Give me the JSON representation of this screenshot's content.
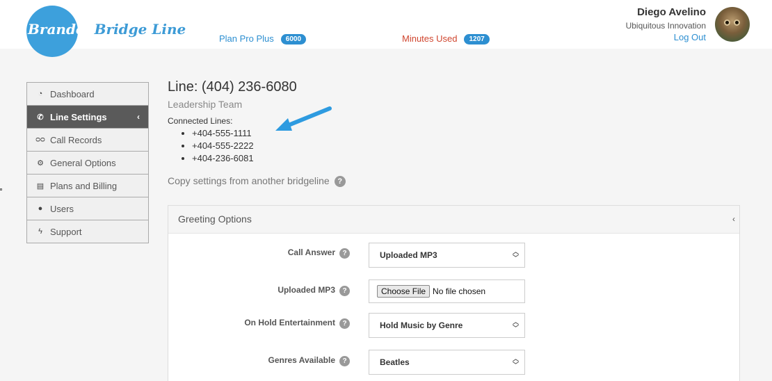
{
  "header": {
    "logo": {
      "text_branded": "Branded",
      "text_bridgeline": "Bridge Line"
    },
    "plan": {
      "label": "Plan Pro Plus",
      "badge": "6000"
    },
    "minutes": {
      "label": "Minutes Used",
      "badge": "1207"
    },
    "user": {
      "name": "Diego Avelino",
      "org": "Ubiquitous Innovation",
      "logout": "Log Out"
    }
  },
  "sidebar": {
    "items": [
      {
        "label": "Dashboard",
        "icon": "gauge-icon"
      },
      {
        "label": "Line Settings",
        "icon": "phone-icon",
        "active": true
      },
      {
        "label": "Call Records",
        "icon": "voicemail-icon"
      },
      {
        "label": "General Options",
        "icon": "gear-icon"
      },
      {
        "label": "Plans and Billing",
        "icon": "card-icon"
      },
      {
        "label": "Users",
        "icon": "user-icon"
      },
      {
        "label": "Support",
        "icon": "bolt-icon"
      }
    ]
  },
  "main": {
    "line_title": "Line: (404) 236-6080",
    "line_subtitle": "Leadership Team",
    "connected_label": "Connected Lines:",
    "connected_lines": [
      "+404-555-1111",
      "+404-555-2222",
      "+404-236-6081"
    ],
    "copy_settings": "Copy settings from another bridgeline",
    "help_glyph": "?"
  },
  "greeting": {
    "title": "Greeting Options",
    "fields": {
      "call_answer": {
        "label": "Call Answer",
        "value": "Uploaded MP3"
      },
      "uploaded_mp3": {
        "label": "Uploaded MP3",
        "button": "Choose File",
        "status": "No file chosen"
      },
      "on_hold": {
        "label": "On Hold Entertainment",
        "value": "Hold Music by Genre"
      },
      "genres": {
        "label": "Genres Available",
        "value": "Beatles"
      }
    }
  },
  "colors": {
    "brand_blue": "#3da0dc",
    "link_blue": "#2d8fd1",
    "minutes_red": "#d0462f",
    "sidebar_active": "#5a5a5a"
  }
}
